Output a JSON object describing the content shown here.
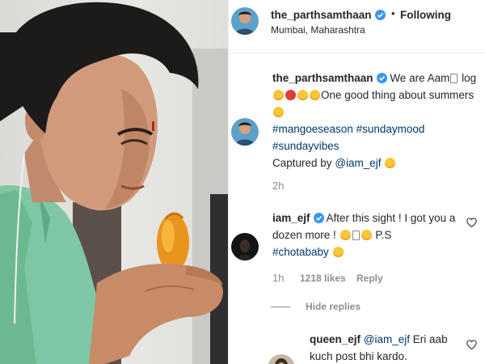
{
  "post": {
    "username": "the_parthsamthaan",
    "follow_label": "Following",
    "location": "Mumbai, Maharashtra"
  },
  "caption": {
    "username": "the_parthsamthaan",
    "text_1": "We are Aam",
    "text_2": "log",
    "text_3": "One good thing about summers",
    "hashtag_1": "#mangoeseason",
    "hashtag_2": "#sundaymood",
    "hashtag_3": "#sundayvibes",
    "credit_prefix": "Captured by",
    "credit_mention": "@iam_ejf",
    "time": "2h"
  },
  "comment_1": {
    "username": "iam_ejf",
    "text_1": "After this sight ! I got you a dozen more !",
    "text_2": "P.S",
    "hashtag": "#chotababy",
    "time": "1h",
    "likes": "1218 likes",
    "reply_label": "Reply"
  },
  "hide_replies_label": "Hide replies",
  "reply_1": {
    "username": "queen_ejf",
    "mention": "@iam_ejf",
    "text": "Eri aab kuch post bhi kardo."
  },
  "icons": {
    "verified": "verified-badge-icon",
    "like": "heart-icon"
  },
  "colors": {
    "verified": "#3897f0",
    "hashtag": "#00376b",
    "meta": "#8e8e8e"
  }
}
